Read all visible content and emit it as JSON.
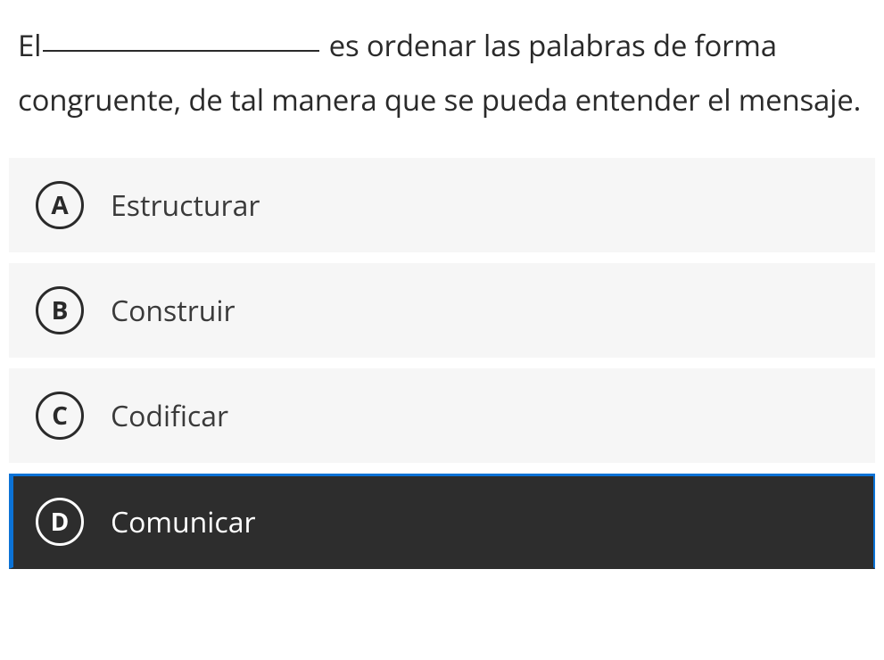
{
  "question": {
    "prefix": "El",
    "suffix": " es ordenar las palabras de forma congruente, de tal manera que se pueda entender el mensaje."
  },
  "options": [
    {
      "letter": "A",
      "text": "Estructurar",
      "selected": false
    },
    {
      "letter": "B",
      "text": "Construir",
      "selected": false
    },
    {
      "letter": "C",
      "text": "Codificar",
      "selected": false
    },
    {
      "letter": "D",
      "text": "Comunicar",
      "selected": true
    }
  ]
}
